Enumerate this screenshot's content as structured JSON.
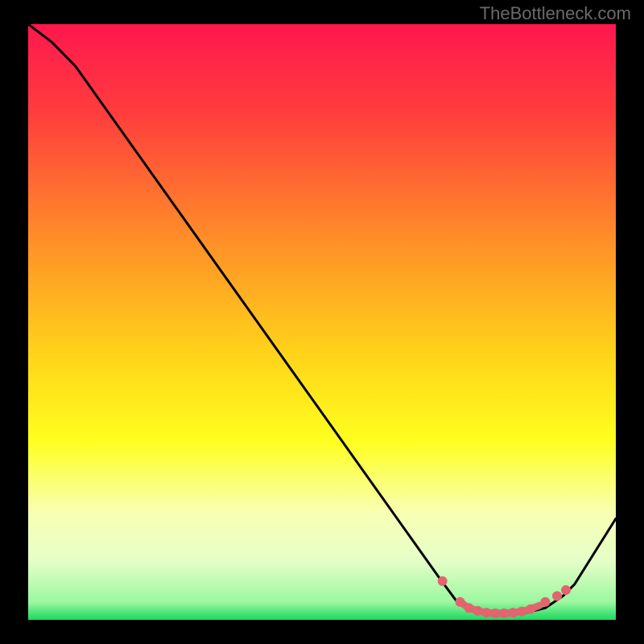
{
  "watermark": "TheBottleneck.com",
  "chart_data": {
    "type": "line",
    "title": "",
    "xlabel": "",
    "ylabel": "",
    "xlim": [
      0,
      100
    ],
    "ylim": [
      0,
      100
    ],
    "background_gradient": {
      "stops": [
        {
          "pos": 0.0,
          "color": "#ff174e"
        },
        {
          "pos": 0.15,
          "color": "#ff3d3d"
        },
        {
          "pos": 0.35,
          "color": "#ff8a29"
        },
        {
          "pos": 0.55,
          "color": "#ffd21a"
        },
        {
          "pos": 0.7,
          "color": "#ffff1f"
        },
        {
          "pos": 0.82,
          "color": "#f8ffb4"
        },
        {
          "pos": 0.9,
          "color": "#e6ffc8"
        },
        {
          "pos": 0.97,
          "color": "#9cf7a0"
        },
        {
          "pos": 1.0,
          "color": "#1bd95f"
        }
      ]
    },
    "series": [
      {
        "name": "curve",
        "color": "#000000",
        "x": [
          0,
          4,
          8,
          70,
          73,
          78,
          84,
          88,
          91,
          93,
          100
        ],
        "y": [
          100,
          97,
          93,
          7,
          3,
          1,
          1,
          2,
          4,
          6,
          17
        ]
      },
      {
        "name": "markers",
        "color": "#e2646f",
        "type": "scatter",
        "x": [
          70.5,
          73.5,
          75.0,
          76.5,
          78.0,
          79.5,
          81.0,
          82.5,
          84.0,
          85.5,
          88.0,
          90.0,
          91.5
        ],
        "y": [
          6.5,
          3.0,
          2.0,
          1.5,
          1.2,
          1.1,
          1.1,
          1.2,
          1.4,
          1.8,
          3.0,
          4.0,
          5.0
        ]
      },
      {
        "name": "markers-thick",
        "color": "#e2646f",
        "type": "line",
        "x": [
          73.5,
          75.0,
          76.5,
          78.0,
          79.5,
          81.0,
          82.5,
          84.0,
          85.5,
          87.0
        ],
        "y": [
          3.0,
          2.0,
          1.5,
          1.2,
          1.1,
          1.1,
          1.2,
          1.4,
          1.8,
          2.4
        ]
      }
    ]
  }
}
